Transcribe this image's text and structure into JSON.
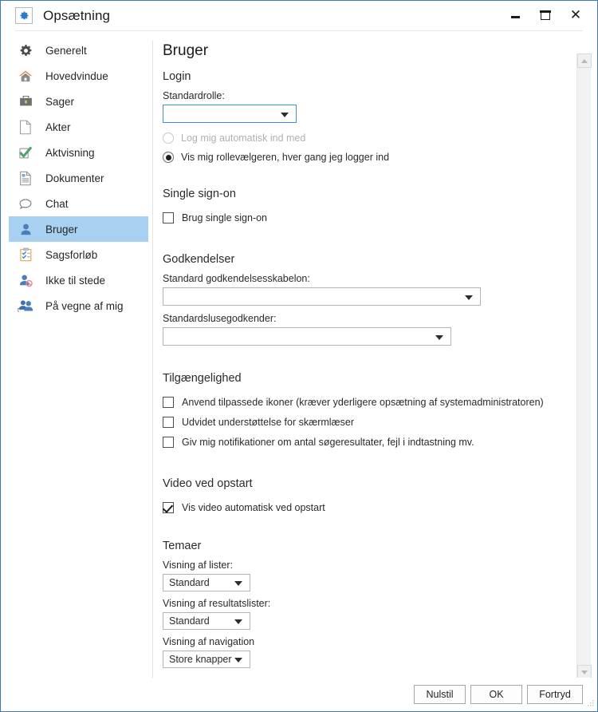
{
  "window": {
    "title": "Opsætning",
    "icon": "gear-icon",
    "controls": {
      "minimize": "minimize-icon",
      "maximize": "maximize-icon",
      "close": "close-icon"
    }
  },
  "sidebar": {
    "items": [
      {
        "label": "Generelt",
        "icon": "gear-icon",
        "selected": false
      },
      {
        "label": "Hovedvindue",
        "icon": "home-icon",
        "selected": false
      },
      {
        "label": "Sager",
        "icon": "briefcase-icon",
        "selected": false
      },
      {
        "label": "Akter",
        "icon": "page-icon",
        "selected": false
      },
      {
        "label": "Aktvisning",
        "icon": "checkmark-icon",
        "selected": false
      },
      {
        "label": "Dokumenter",
        "icon": "document-icon",
        "selected": false
      },
      {
        "label": "Chat",
        "icon": "chat-bubble-icon",
        "selected": false
      },
      {
        "label": "Bruger",
        "icon": "user-icon",
        "selected": true
      },
      {
        "label": "Sagsforløb",
        "icon": "clipboard-icon",
        "selected": false
      },
      {
        "label": "Ikke til stede",
        "icon": "user-blocked-icon",
        "selected": false
      },
      {
        "label": "På vegne af mig",
        "icon": "users-icon",
        "selected": false
      }
    ]
  },
  "main": {
    "page_title": "Bruger",
    "login": {
      "heading": "Login",
      "default_role_label": "Standardrolle:",
      "default_role_value": "",
      "auto_login_label": "Log mig automatisk ind med",
      "auto_login_selected": false,
      "auto_login_disabled": true,
      "role_picker_label": "Vis mig rollevælgeren, hver gang jeg logger ind",
      "role_picker_selected": true
    },
    "single_sign_on": {
      "heading": "Single sign-on",
      "checkbox_label": "Brug single sign-on",
      "checked": false
    },
    "approvals": {
      "heading": "Godkendelser",
      "template_label": "Standard godkendelsesskabelon:",
      "template_value": "",
      "approver_label": "Standardslusegodkender:",
      "approver_value": ""
    },
    "accessibility": {
      "heading": "Tilgængelighed",
      "options": [
        {
          "label": "Anvend tilpassede ikoner (kræver yderligere opsætning af systemadministratoren)",
          "checked": false
        },
        {
          "label": "Udvidet understøttelse for skærmlæser",
          "checked": false
        },
        {
          "label": "Giv mig notifikationer om antal søgeresultater, fejl i indtastning mv.",
          "checked": false
        }
      ]
    },
    "startup_video": {
      "heading": "Video ved opstart",
      "checkbox_label": "Vis video automatisk ved opstart",
      "checked": true
    },
    "themes": {
      "heading": "Temaer",
      "lists_label": "Visning af lister:",
      "lists_value": "Standard",
      "result_lists_label": "Visning af resultatslister:",
      "result_lists_value": "Standard",
      "navigation_label": "Visning af navigation",
      "navigation_value": "Store knapper"
    }
  },
  "footer": {
    "reset": "Nulstil",
    "ok": "OK",
    "cancel": "Fortryd"
  },
  "colors": {
    "window_border": "#3b78c3",
    "selection": "#a8d0f0",
    "focus_border": "#3b8fdc",
    "accent_icon": "#4a7ebb"
  }
}
